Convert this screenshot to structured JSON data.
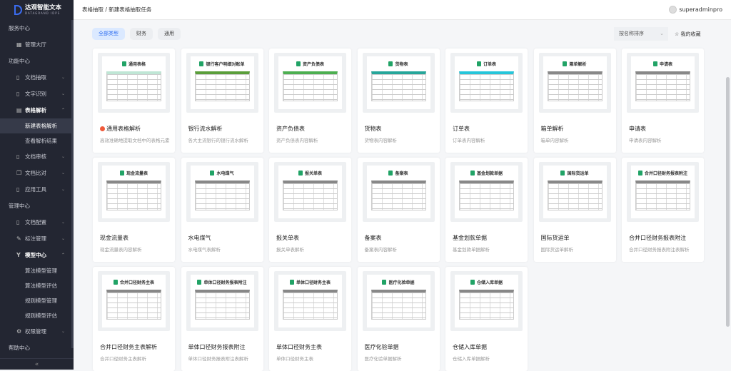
{
  "brand": {
    "name": "达观智能文本",
    "sub": "DATAGRAND IDPS"
  },
  "sidebar": [
    {
      "type": "sec",
      "label": "服务中心"
    },
    {
      "type": "item",
      "label": "管理大厅",
      "icon": "grid-icon"
    },
    {
      "type": "sec",
      "label": "功能中心"
    },
    {
      "type": "item",
      "label": "文档抽取",
      "icon": "file-icon",
      "chev": "⌄"
    },
    {
      "type": "item",
      "label": "文字识别",
      "icon": "file-icon",
      "chev": "⌄"
    },
    {
      "type": "item",
      "label": "表格解析",
      "icon": "table-icon",
      "chev": "⌃",
      "bold": true
    },
    {
      "type": "sub",
      "label": "新建表格解析",
      "active": true
    },
    {
      "type": "sub",
      "label": "查看解析结果"
    },
    {
      "type": "item",
      "label": "文档审核",
      "icon": "file-icon",
      "chev": "⌄"
    },
    {
      "type": "item",
      "label": "文档比对",
      "icon": "copy-icon",
      "chev": "⌄"
    },
    {
      "type": "item",
      "label": "应用工具",
      "icon": "file-icon",
      "chev": "⌄"
    },
    {
      "type": "sec",
      "label": "管理中心"
    },
    {
      "type": "item",
      "label": "文档配置",
      "icon": "doc-icon",
      "chev": "⌄"
    },
    {
      "type": "item",
      "label": "标注管理",
      "icon": "edit-icon",
      "chev": "⌄"
    },
    {
      "type": "item",
      "label": "模型中心",
      "icon": "model-icon",
      "chev": "⌃",
      "bold": true
    },
    {
      "type": "sub",
      "label": "算法模型管理"
    },
    {
      "type": "sub",
      "label": "算法模型评估"
    },
    {
      "type": "sub",
      "label": "规则模型管理"
    },
    {
      "type": "sub",
      "label": "规则模型评估"
    },
    {
      "type": "item",
      "label": "权限管理",
      "icon": "gear-icon",
      "chev": "⌄"
    },
    {
      "type": "sec",
      "label": "帮助中心"
    }
  ],
  "collapse": "«",
  "header": {
    "breadcrumb": "表格抽取 / 新建表格抽取任务",
    "user": "superadminpro"
  },
  "filters": [
    {
      "label": "全部类型",
      "active": true
    },
    {
      "label": "财务"
    },
    {
      "label": "通用"
    }
  ],
  "sort": {
    "label": "按名称排序",
    "chevron": "⌄"
  },
  "favorites": "☆ 我的收藏",
  "accent": "#2f6ef0",
  "cards": [
    {
      "thumb": "通用表格",
      "name": "通用表格解析",
      "desc": "高效准确地提取文档中的表格元素",
      "hot": true,
      "color": "#bfe6d5"
    },
    {
      "thumb": "银行客户明细对账单",
      "name": "银行流水解析",
      "desc": "各大主流银行的银行流水解析",
      "color": "#5a9e3a"
    },
    {
      "thumb": "资产负债表",
      "name": "资产负债表",
      "desc": "资产负债表内容解析",
      "color": "#4caf50"
    },
    {
      "thumb": "货物表",
      "name": "货物表",
      "desc": "货物表内容解析",
      "color": "#26a69a"
    },
    {
      "thumb": "订单表",
      "name": "订单表",
      "desc": "订单表内容解析",
      "color": "#26c6da"
    },
    {
      "thumb": "箱单解析",
      "name": "箱单解析",
      "desc": "箱单内容解析",
      "color": "#888"
    },
    {
      "thumb": "申请表",
      "name": "申请表",
      "desc": "申请表内容解析",
      "color": "#888"
    },
    {
      "thumb": "现金流量表",
      "name": "现金流量表",
      "desc": "现金流量表内容解析",
      "color": "#888"
    },
    {
      "thumb": "水电煤气",
      "name": "水电煤气",
      "desc": "水电煤气表解析",
      "color": "#888"
    },
    {
      "thumb": "报关单表",
      "name": "报关单表",
      "desc": "报关单表解析",
      "color": "#888"
    },
    {
      "thumb": "备案表",
      "name": "备案表",
      "desc": "备案表内容解析",
      "color": "#888"
    },
    {
      "thumb": "基金划款单据",
      "name": "基金划款单据",
      "desc": "基金划款单据解析",
      "color": "#888"
    },
    {
      "thumb": "国际货运单",
      "name": "国际货运单",
      "desc": "国际货运单解析",
      "color": "#888"
    },
    {
      "thumb": "合并口径财务报表附注",
      "name": "合并口径财务报表附注",
      "desc": "合并口径财务报表附注表解析",
      "color": "#888"
    },
    {
      "thumb": "合并口径财务主表",
      "name": "合并口径财务主表解析",
      "desc": "合并口径财务主表解析",
      "color": "#888"
    },
    {
      "thumb": "单体口径财务报表附注",
      "name": "单体口径财务报表附注",
      "desc": "单体口径财务报表附注表解析",
      "color": "#888"
    },
    {
      "thumb": "单体口径财务主表",
      "name": "单体口径财务主表",
      "desc": "单体口径财务主表",
      "color": "#888"
    },
    {
      "thumb": "医疗化验单据",
      "name": "医疗化验单据",
      "desc": "医疗化验单据解析",
      "color": "#888"
    },
    {
      "thumb": "仓储入库单据",
      "name": "仓储入库单据",
      "desc": "仓储入库单据解析",
      "color": "#888"
    }
  ]
}
